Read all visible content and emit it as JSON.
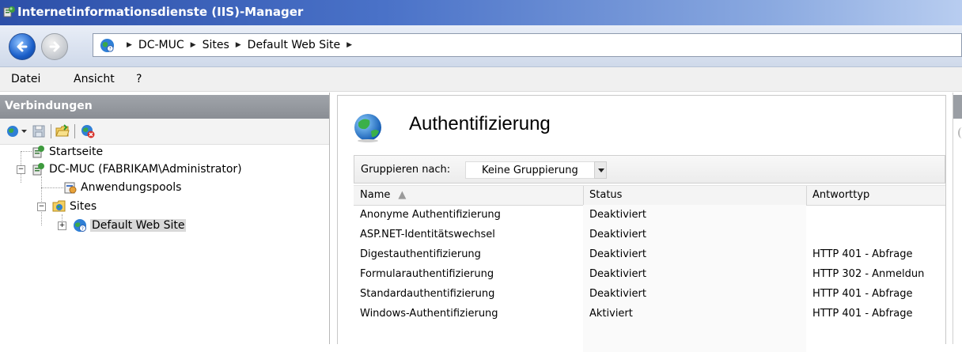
{
  "window": {
    "title": "Internetinformationsdienste (IIS)-Manager"
  },
  "address": {
    "crumbs": [
      "DC-MUC",
      "Sites",
      "Default Web Site"
    ]
  },
  "menu": {
    "items": [
      "Datei",
      "Ansicht",
      "?"
    ]
  },
  "connections": {
    "title": "Verbindungen",
    "tree": {
      "start": "Startseite",
      "server": "DC-MUC (FABRIKAM\\Administrator)",
      "app_pools": "Anwendungspools",
      "sites": "Sites",
      "default_site": "Default Web Site"
    }
  },
  "feature": {
    "title": "Authentifizierung",
    "group_label": "Gruppieren nach:",
    "group_value": "Keine Gruppierung",
    "columns": {
      "name": "Name",
      "status": "Status",
      "type": "Antworttyp"
    },
    "rows": [
      {
        "name": "Anonyme Authentifizierung",
        "status": "Deaktiviert",
        "type": ""
      },
      {
        "name": "ASP.NET-Identitätswechsel",
        "status": "Deaktiviert",
        "type": ""
      },
      {
        "name": "Digestauthentifizierung",
        "status": "Deaktiviert",
        "type": "HTTP 401 - Abfrage"
      },
      {
        "name": "Formularauthentifizierung",
        "status": "Deaktiviert",
        "type": "HTTP 302 - Anmeldun"
      },
      {
        "name": "Standardauthentifizierung",
        "status": "Deaktiviert",
        "type": "HTTP 401 - Abfrage"
      },
      {
        "name": "Windows-Authentifizierung",
        "status": "Aktiviert",
        "type": "HTTP 401 - Abfrage"
      }
    ]
  },
  "colors": {
    "titlebar": "#2c4fa8",
    "panel_header": "#9a9ea4",
    "selection": "#d9d9d9"
  }
}
